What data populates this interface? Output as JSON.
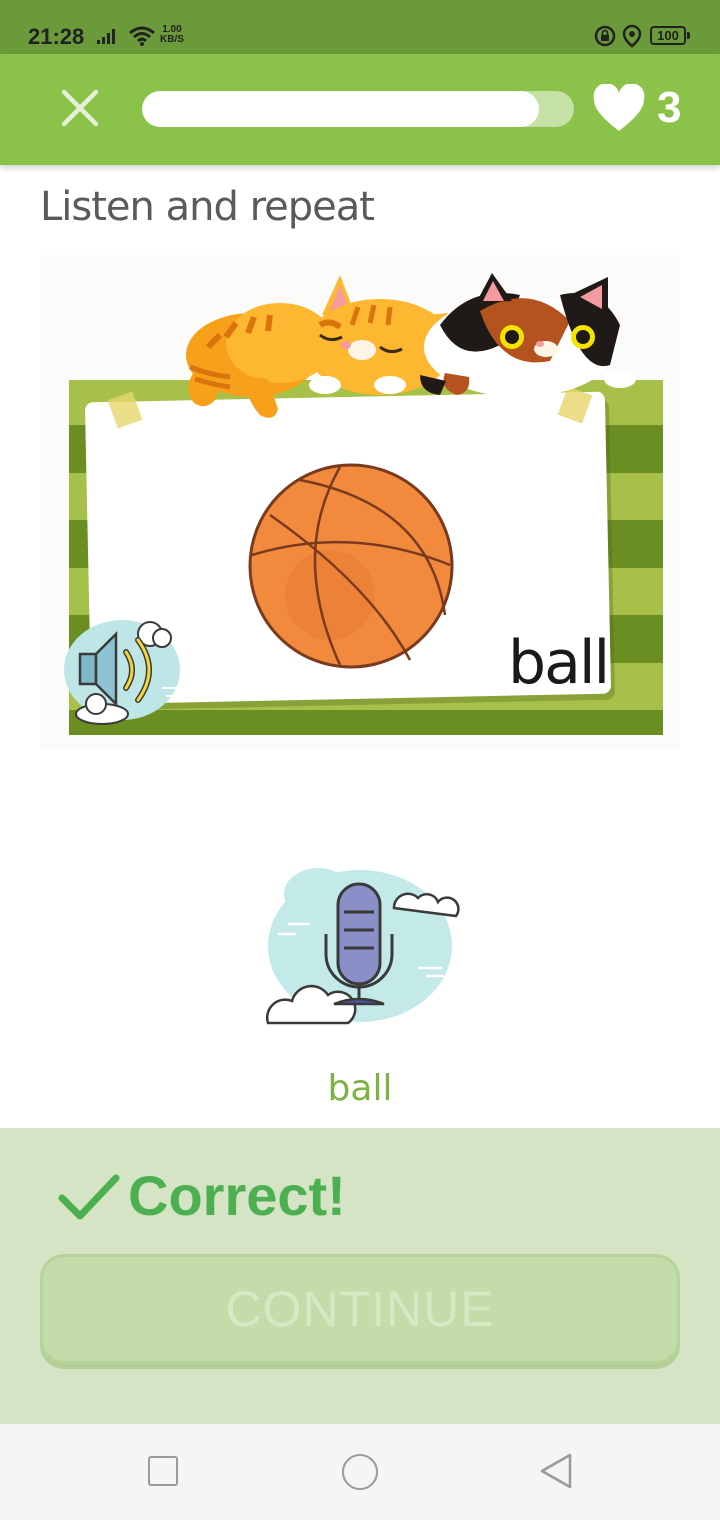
{
  "status_bar": {
    "time": "21:28",
    "net_speed_value": "1.00",
    "net_speed_unit": "KB/S",
    "battery": "100",
    "icons": [
      "signal-icon",
      "wifi-icon",
      "lock-icon",
      "location-icon",
      "battery-icon"
    ]
  },
  "header": {
    "close_icon": "close-icon",
    "progress_fraction": 0.92,
    "lives_icon": "heart-icon",
    "lives": "3"
  },
  "exercise": {
    "prompt": "Listen and repeat",
    "card_word": "ball",
    "card_image": "basketball-with-cats",
    "speaker_icon": "speaker-icon",
    "mic_icon": "microphone-icon",
    "recognized_text": "ball"
  },
  "feedback": {
    "check_icon": "check-icon",
    "status": "Correct!",
    "continue_label": "CONTINUE"
  },
  "nav_bar": {
    "icons": [
      "recent-apps-icon",
      "home-icon",
      "back-icon"
    ]
  },
  "colors": {
    "header_green": "#8bc34a",
    "status_bar": "#6a9a3a",
    "correct_green": "#4caf50",
    "feedback_panel": "#d4e4c5",
    "recognized_text": "#7cb342"
  }
}
